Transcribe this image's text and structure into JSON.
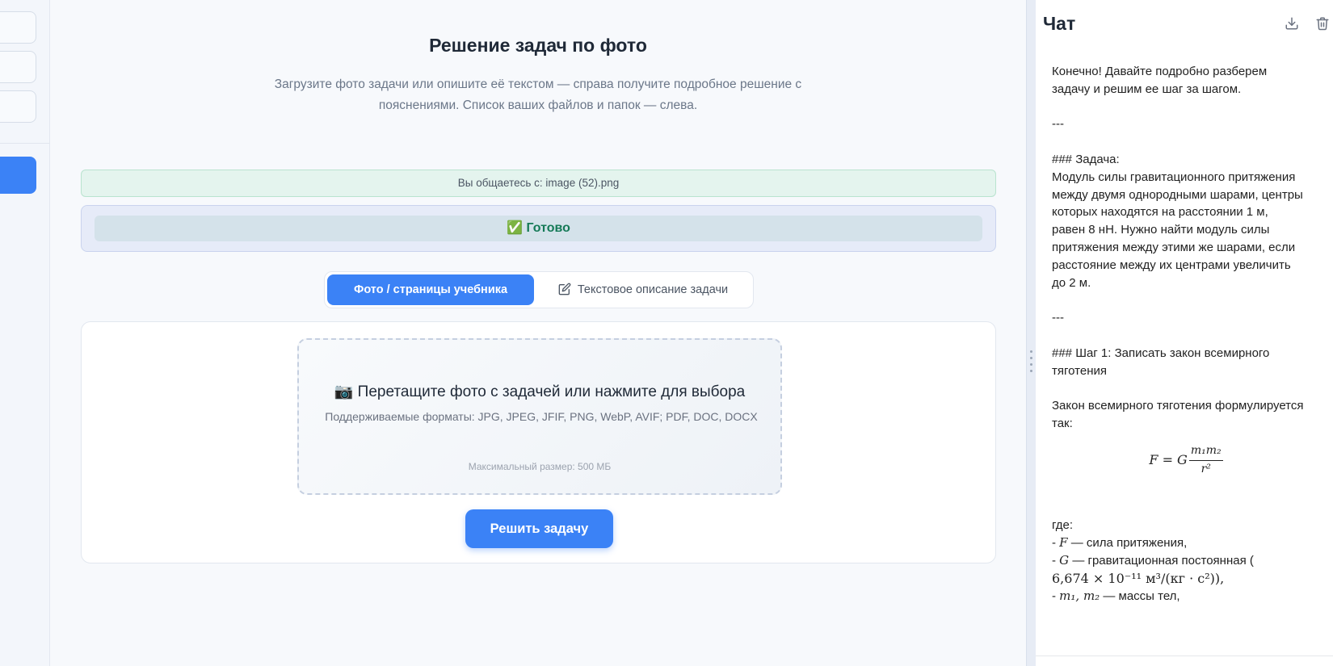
{
  "main": {
    "title": "Решение задач по фото",
    "subtitle": "Загрузите фото задачи или опишите её текстом — справа получите подробное решение с пояснениями. Список ваших файлов и папок — слева.",
    "chat_with": "Вы общаетесь с: image (52).png",
    "status": "✅ Готово",
    "tabs": [
      {
        "label": "Фото / страницы учебника",
        "active": true
      },
      {
        "label": "Текстовое описание задачи",
        "active": false
      }
    ],
    "dropzone": {
      "title": "📷 Перетащите фото с задачей или нажмите для выбора",
      "formats": "Поддерживаемые форматы: JPG, JPEG, JFIF, PNG, WebP, AVIF; PDF, DOC, DOCX",
      "max_size": "Максимальный размер: 500 МБ"
    },
    "solve_button": "Решить задачу"
  },
  "chat": {
    "title": "Чат",
    "icons": [
      "download-icon",
      "trash-icon"
    ],
    "messages": {
      "intro": "Конечно! Давайте подробно разберем задачу и решим ее шаг за шагом.",
      "sep1": "---",
      "task_heading": "### Задача:",
      "task_text": "Модуль силы гравитационного притяжения между двумя однородными шарами, центры которых находятся на расстоянии 1 м, равен 8 нН. Нужно найти модуль силы притяжения между этими же шарами, если расстояние между их центрами увеличить до 2 м.",
      "sep2": "---",
      "step1_heading": "### Шаг 1: Записать закон всемирного тяготения",
      "law_text": "Закон всемирного тяготения формулируется так:",
      "formula_lhs": "F = G",
      "formula_num": "m₁m₂",
      "formula_den": "r²",
      "where": "где:",
      "item_f_sym": "F",
      "item_f_text": " — сила притяжения,",
      "item_g_sym": "G",
      "item_g_text": " — гравитационная постоянная (",
      "item_g_value": "6,674 × 10⁻¹¹ м³/(кг · с²)),",
      "item_m_sym": "m₁, m₂",
      "item_m_text": " — массы тел,"
    }
  },
  "colors": {
    "accent": "#3b82f6",
    "success_bg": "#e4f4ee",
    "status_text": "#157a57"
  }
}
